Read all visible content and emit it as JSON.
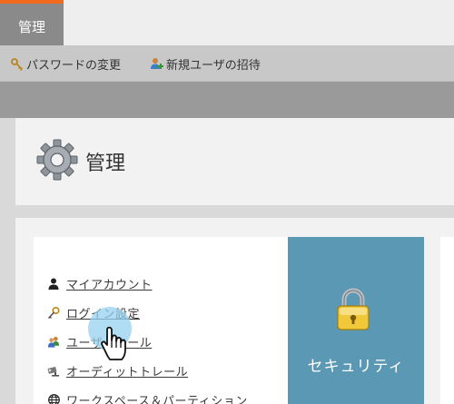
{
  "tabs": [
    {
      "label": "管理"
    }
  ],
  "toolbar": {
    "change_password": "パスワードの変更",
    "invite_user": "新規ユーザの招待"
  },
  "header": {
    "title": "管理"
  },
  "menu": {
    "items": [
      {
        "label": "マイアカウント",
        "icon": "user-icon"
      },
      {
        "label": "ログイン設定",
        "icon": "key-icon"
      },
      {
        "label": "ユーザ＆ロール",
        "icon": "users-icon"
      },
      {
        "label": "オーディットトレール",
        "icon": "camera-icon"
      },
      {
        "label": "ワークスペース＆パーティション",
        "icon": "globe-icon"
      }
    ]
  },
  "security_tile": {
    "label": "セキュリティ",
    "icon": "lock-icon"
  },
  "colors": {
    "accent": "#f26a1b",
    "tile": "#5b98b3",
    "tab_bg": "#8a8a8a"
  }
}
